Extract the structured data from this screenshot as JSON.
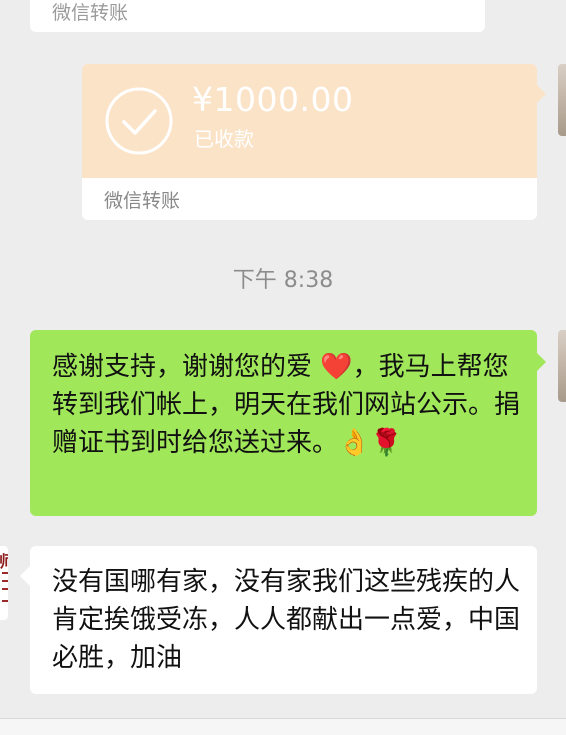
{
  "messages": {
    "prev_transfer": {
      "label": "微信转账"
    },
    "transfer": {
      "amount": "¥1000.00",
      "status": "已收款",
      "label": "微信转账",
      "card_color": "#fbe3c8"
    },
    "timestamp": "下午 8:38",
    "outgoing": {
      "text": "感谢支持，谢谢您的爱 ❤️，我马上帮您转到我们帐上，明天在我们网站公示。捐赠证书到时给您送过来。👌🌹",
      "bubble_color": "#a0e75a"
    },
    "incoming": {
      "text": "没有国哪有家，没有家我们这些残疾的人肯定挨饿受冻，人人都献出一点爱，中国必胜，加油",
      "bubble_color": "#ffffff"
    }
  },
  "icons": {
    "received_check": "check-circle-icon"
  }
}
